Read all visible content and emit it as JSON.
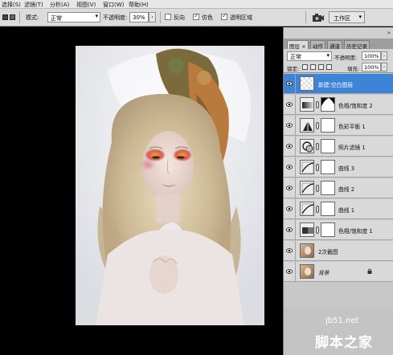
{
  "menu": [
    "选择(S)",
    "滤镜(T)",
    "分析(A)",
    "视图(V)",
    "窗口(W)",
    "帮助(H)"
  ],
  "options": {
    "mode_label": "模式:",
    "mode_value": "正常",
    "opacity_label": "不透明度:",
    "opacity_value": "30%",
    "reverse_label": "反向",
    "dither_label": "仿色",
    "transparency_label": "透明区域",
    "reverse_checked": false,
    "dither_checked": true,
    "transparency_checked": true,
    "workspace_label": "工作区"
  },
  "panel": {
    "tabs": [
      "图层 ×",
      "动作",
      "通道",
      "历史记录"
    ],
    "blend_mode": "正常",
    "opacity_label": "不透明度:",
    "opacity_value": "100%",
    "lock_label": "锁定:",
    "fill_label": "填充:",
    "fill_value": "100%"
  },
  "layers": [
    {
      "name": "新建:空白图层",
      "thumb": "transparent",
      "selected": true,
      "mask": false
    },
    {
      "name": "色相/饱和度 2",
      "thumb": "hue-sat",
      "selected": false,
      "mask": "black-white"
    },
    {
      "name": "色彩平衡 1",
      "thumb": "color-balance",
      "selected": false,
      "mask": "white"
    },
    {
      "name": "照片滤镜 1",
      "thumb": "photo-filter",
      "selected": false,
      "mask": "white"
    },
    {
      "name": "曲线 3",
      "thumb": "curves",
      "selected": false,
      "mask": "white"
    },
    {
      "name": "曲线 2",
      "thumb": "curves",
      "selected": false,
      "mask": "white"
    },
    {
      "name": "曲线 1",
      "thumb": "curves",
      "selected": false,
      "mask": "white"
    },
    {
      "name": "色相/饱和度 1",
      "thumb": "hue-sat",
      "selected": false,
      "mask": "white"
    },
    {
      "name": "2次截图",
      "thumb": "photo",
      "selected": false,
      "mask": false
    },
    {
      "name": "背景",
      "thumb": "photo",
      "selected": false,
      "mask": false,
      "locked": true
    }
  ],
  "watermark": {
    "site": "jb51.net",
    "brand": "脚本之家"
  },
  "colors": {
    "selected_layer": "#3d84d8",
    "canvas_bg": "#000000",
    "panel_bg": "#c8c8c8"
  }
}
